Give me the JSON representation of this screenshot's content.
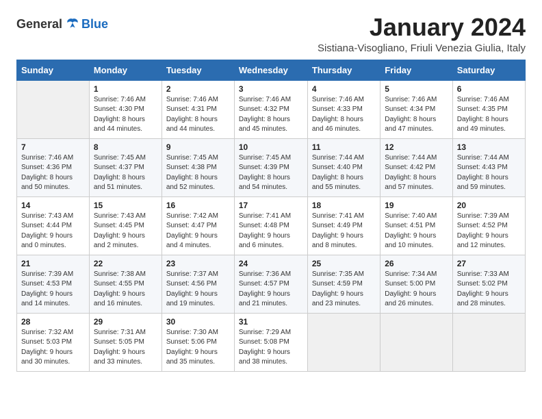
{
  "header": {
    "logo_general": "General",
    "logo_blue": "Blue",
    "month_title": "January 2024",
    "subtitle": "Sistiana-Visogliano, Friuli Venezia Giulia, Italy"
  },
  "weekdays": [
    "Sunday",
    "Monday",
    "Tuesday",
    "Wednesday",
    "Thursday",
    "Friday",
    "Saturday"
  ],
  "weeks": [
    [
      {
        "day": "",
        "sunrise": "",
        "sunset": "",
        "daylight": ""
      },
      {
        "day": "1",
        "sunrise": "Sunrise: 7:46 AM",
        "sunset": "Sunset: 4:30 PM",
        "daylight": "Daylight: 8 hours and 44 minutes."
      },
      {
        "day": "2",
        "sunrise": "Sunrise: 7:46 AM",
        "sunset": "Sunset: 4:31 PM",
        "daylight": "Daylight: 8 hours and 44 minutes."
      },
      {
        "day": "3",
        "sunrise": "Sunrise: 7:46 AM",
        "sunset": "Sunset: 4:32 PM",
        "daylight": "Daylight: 8 hours and 45 minutes."
      },
      {
        "day": "4",
        "sunrise": "Sunrise: 7:46 AM",
        "sunset": "Sunset: 4:33 PM",
        "daylight": "Daylight: 8 hours and 46 minutes."
      },
      {
        "day": "5",
        "sunrise": "Sunrise: 7:46 AM",
        "sunset": "Sunset: 4:34 PM",
        "daylight": "Daylight: 8 hours and 47 minutes."
      },
      {
        "day": "6",
        "sunrise": "Sunrise: 7:46 AM",
        "sunset": "Sunset: 4:35 PM",
        "daylight": "Daylight: 8 hours and 49 minutes."
      }
    ],
    [
      {
        "day": "7",
        "sunrise": "Sunrise: 7:46 AM",
        "sunset": "Sunset: 4:36 PM",
        "daylight": "Daylight: 8 hours and 50 minutes."
      },
      {
        "day": "8",
        "sunrise": "Sunrise: 7:45 AM",
        "sunset": "Sunset: 4:37 PM",
        "daylight": "Daylight: 8 hours and 51 minutes."
      },
      {
        "day": "9",
        "sunrise": "Sunrise: 7:45 AM",
        "sunset": "Sunset: 4:38 PM",
        "daylight": "Daylight: 8 hours and 52 minutes."
      },
      {
        "day": "10",
        "sunrise": "Sunrise: 7:45 AM",
        "sunset": "Sunset: 4:39 PM",
        "daylight": "Daylight: 8 hours and 54 minutes."
      },
      {
        "day": "11",
        "sunrise": "Sunrise: 7:44 AM",
        "sunset": "Sunset: 4:40 PM",
        "daylight": "Daylight: 8 hours and 55 minutes."
      },
      {
        "day": "12",
        "sunrise": "Sunrise: 7:44 AM",
        "sunset": "Sunset: 4:42 PM",
        "daylight": "Daylight: 8 hours and 57 minutes."
      },
      {
        "day": "13",
        "sunrise": "Sunrise: 7:44 AM",
        "sunset": "Sunset: 4:43 PM",
        "daylight": "Daylight: 8 hours and 59 minutes."
      }
    ],
    [
      {
        "day": "14",
        "sunrise": "Sunrise: 7:43 AM",
        "sunset": "Sunset: 4:44 PM",
        "daylight": "Daylight: 9 hours and 0 minutes."
      },
      {
        "day": "15",
        "sunrise": "Sunrise: 7:43 AM",
        "sunset": "Sunset: 4:45 PM",
        "daylight": "Daylight: 9 hours and 2 minutes."
      },
      {
        "day": "16",
        "sunrise": "Sunrise: 7:42 AM",
        "sunset": "Sunset: 4:47 PM",
        "daylight": "Daylight: 9 hours and 4 minutes."
      },
      {
        "day": "17",
        "sunrise": "Sunrise: 7:41 AM",
        "sunset": "Sunset: 4:48 PM",
        "daylight": "Daylight: 9 hours and 6 minutes."
      },
      {
        "day": "18",
        "sunrise": "Sunrise: 7:41 AM",
        "sunset": "Sunset: 4:49 PM",
        "daylight": "Daylight: 9 hours and 8 minutes."
      },
      {
        "day": "19",
        "sunrise": "Sunrise: 7:40 AM",
        "sunset": "Sunset: 4:51 PM",
        "daylight": "Daylight: 9 hours and 10 minutes."
      },
      {
        "day": "20",
        "sunrise": "Sunrise: 7:39 AM",
        "sunset": "Sunset: 4:52 PM",
        "daylight": "Daylight: 9 hours and 12 minutes."
      }
    ],
    [
      {
        "day": "21",
        "sunrise": "Sunrise: 7:39 AM",
        "sunset": "Sunset: 4:53 PM",
        "daylight": "Daylight: 9 hours and 14 minutes."
      },
      {
        "day": "22",
        "sunrise": "Sunrise: 7:38 AM",
        "sunset": "Sunset: 4:55 PM",
        "daylight": "Daylight: 9 hours and 16 minutes."
      },
      {
        "day": "23",
        "sunrise": "Sunrise: 7:37 AM",
        "sunset": "Sunset: 4:56 PM",
        "daylight": "Daylight: 9 hours and 19 minutes."
      },
      {
        "day": "24",
        "sunrise": "Sunrise: 7:36 AM",
        "sunset": "Sunset: 4:57 PM",
        "daylight": "Daylight: 9 hours and 21 minutes."
      },
      {
        "day": "25",
        "sunrise": "Sunrise: 7:35 AM",
        "sunset": "Sunset: 4:59 PM",
        "daylight": "Daylight: 9 hours and 23 minutes."
      },
      {
        "day": "26",
        "sunrise": "Sunrise: 7:34 AM",
        "sunset": "Sunset: 5:00 PM",
        "daylight": "Daylight: 9 hours and 26 minutes."
      },
      {
        "day": "27",
        "sunrise": "Sunrise: 7:33 AM",
        "sunset": "Sunset: 5:02 PM",
        "daylight": "Daylight: 9 hours and 28 minutes."
      }
    ],
    [
      {
        "day": "28",
        "sunrise": "Sunrise: 7:32 AM",
        "sunset": "Sunset: 5:03 PM",
        "daylight": "Daylight: 9 hours and 30 minutes."
      },
      {
        "day": "29",
        "sunrise": "Sunrise: 7:31 AM",
        "sunset": "Sunset: 5:05 PM",
        "daylight": "Daylight: 9 hours and 33 minutes."
      },
      {
        "day": "30",
        "sunrise": "Sunrise: 7:30 AM",
        "sunset": "Sunset: 5:06 PM",
        "daylight": "Daylight: 9 hours and 35 minutes."
      },
      {
        "day": "31",
        "sunrise": "Sunrise: 7:29 AM",
        "sunset": "Sunset: 5:08 PM",
        "daylight": "Daylight: 9 hours and 38 minutes."
      },
      {
        "day": "",
        "sunrise": "",
        "sunset": "",
        "daylight": ""
      },
      {
        "day": "",
        "sunrise": "",
        "sunset": "",
        "daylight": ""
      },
      {
        "day": "",
        "sunrise": "",
        "sunset": "",
        "daylight": ""
      }
    ]
  ]
}
